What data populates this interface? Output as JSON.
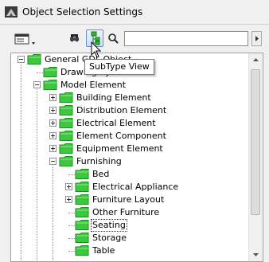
{
  "window": {
    "title": "Object Selection Settings"
  },
  "toolbar": {
    "search_value": "",
    "tooltip": "SubType View",
    "buttons": [
      "view-mode-icon",
      "funnel-icon",
      "subtype-icon",
      "search-icon",
      "chevron-right-icon"
    ]
  },
  "tree": {
    "nodes": [
      {
        "label": "General GDL Object",
        "expander": "minus",
        "depth": 0
      },
      {
        "label": "Drawing Symbol",
        "expander": "none",
        "depth": 1
      },
      {
        "label": "Model Element",
        "expander": "minus",
        "depth": 1
      },
      {
        "label": "Building Element",
        "expander": "plus",
        "depth": 2
      },
      {
        "label": "Distribution Element",
        "expander": "plus",
        "depth": 2
      },
      {
        "label": "Electrical Element",
        "expander": "plus",
        "depth": 2
      },
      {
        "label": "Element Component",
        "expander": "plus",
        "depth": 2
      },
      {
        "label": "Equipment Element",
        "expander": "plus",
        "depth": 2
      },
      {
        "label": "Furnishing",
        "expander": "minus",
        "depth": 2
      },
      {
        "label": "Bed",
        "expander": "none",
        "depth": 3
      },
      {
        "label": "Electrical Appliance",
        "expander": "plus",
        "depth": 3
      },
      {
        "label": "Furniture Layout",
        "expander": "plus",
        "depth": 3
      },
      {
        "label": "Other Furniture",
        "expander": "none",
        "depth": 3
      },
      {
        "label": "Seating",
        "expander": "none",
        "depth": 3,
        "selected": true
      },
      {
        "label": "Storage",
        "expander": "none",
        "depth": 3
      },
      {
        "label": "Table",
        "expander": "none",
        "depth": 3
      }
    ]
  },
  "colors": {
    "folder": "#3cc83c",
    "folder_dark": "#1e8c1e",
    "tooltip_border": "#767676",
    "accent": "#6a8fc0"
  }
}
